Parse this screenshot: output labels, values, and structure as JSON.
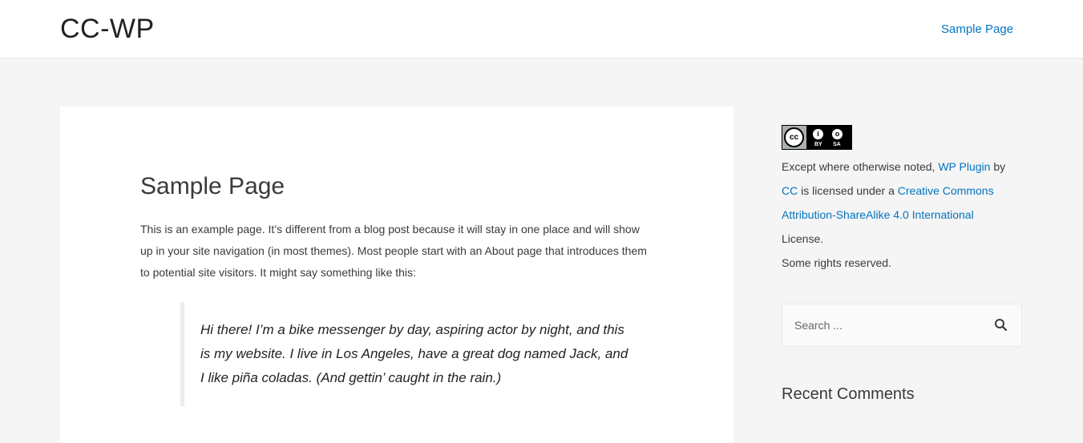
{
  "header": {
    "site_title": "CC-WP",
    "nav": [
      {
        "label": "Sample Page"
      }
    ]
  },
  "main": {
    "title": "Sample Page",
    "intro": "This is an example page. It’s different from a blog post because it will stay in one place and will show up in your site navigation (in most themes). Most people start with an About page that introduces them to potential site visitors. It might say something like this:",
    "quote": "Hi there! I’m a bike messenger by day, aspiring actor by night, and this is my website. I live in Los Angeles, have a great dog named Jack, and I like piña coladas. (And gettin’ caught in the rain.)"
  },
  "sidebar": {
    "badge": {
      "cc": "cc",
      "by_symbol": "i",
      "sa_symbol": "o",
      "by": "BY",
      "sa": "SA"
    },
    "license": {
      "prefix": "Except where otherwise noted,",
      "work_link": "WP Plugin",
      "by_word": "by",
      "author_link": "CC",
      "middle": "is licensed under a",
      "license_link": "Creative Commons Attribution-ShareAlike 4.0 International",
      "suffix": "License.",
      "rights": "Some rights reserved."
    },
    "search": {
      "placeholder": "Search ...",
      "icon": "search-icon"
    },
    "recent_comments_title": "Recent Comments"
  },
  "colors": {
    "link": "#0274be",
    "background": "#f5f5f5",
    "text": "#3a3a3a"
  }
}
